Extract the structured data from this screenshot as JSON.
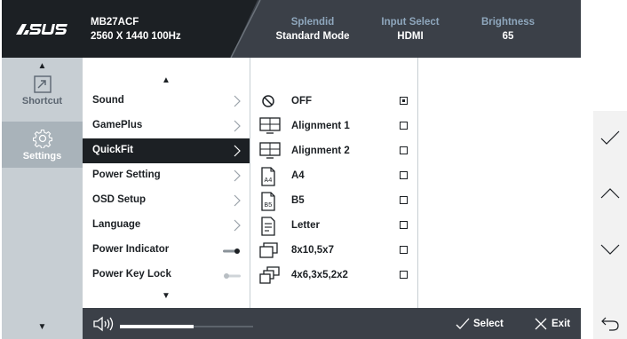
{
  "header": {
    "brand": "ASUS",
    "model_name": "MB27ACF",
    "model_resolution": "2560 X 1440 100Hz",
    "items": [
      {
        "label": "Splendid",
        "value": "Standard Mode"
      },
      {
        "label": "Input Select",
        "value": "HDMI"
      },
      {
        "label": "Brightness",
        "value": "65"
      }
    ]
  },
  "sidebar": {
    "items": [
      {
        "label": "Shortcut",
        "icon": "shortcut-icon",
        "active": false
      },
      {
        "label": "Settings",
        "icon": "gear-icon",
        "active": true
      }
    ]
  },
  "menu": {
    "items": [
      {
        "label": "Sound",
        "type": "submenu",
        "active": false
      },
      {
        "label": "GamePlus",
        "type": "submenu",
        "active": false
      },
      {
        "label": "QuickFit",
        "type": "submenu",
        "active": true
      },
      {
        "label": "Power Setting",
        "type": "submenu",
        "active": false
      },
      {
        "label": "OSD Setup",
        "type": "submenu",
        "active": false
      },
      {
        "label": "Language",
        "type": "submenu",
        "active": false
      },
      {
        "label": "Power Indicator",
        "type": "toggle",
        "on": true
      },
      {
        "label": "Power Key Lock",
        "type": "toggle",
        "on": false
      }
    ]
  },
  "options": {
    "items": [
      {
        "label": "OFF",
        "icon": "off-circle-icon",
        "checked": true
      },
      {
        "label": "Alignment 1",
        "icon": "alignment-grid-icon",
        "checked": false
      },
      {
        "label": "Alignment 2",
        "icon": "alignment-grid-icon",
        "checked": false
      },
      {
        "label": "A4",
        "icon": "a4-paper-icon",
        "checked": false
      },
      {
        "label": "B5",
        "icon": "b5-paper-icon",
        "checked": false
      },
      {
        "label": "Letter",
        "icon": "letter-paper-icon",
        "checked": false
      },
      {
        "label": "8x10,5x7",
        "icon": "photo-frame-icon",
        "checked": false
      },
      {
        "label": "4x6,3x5,2x2",
        "icon": "photo-frame-stack-icon",
        "checked": false
      }
    ]
  },
  "bottom": {
    "volume_fraction": 0.55,
    "select_label": "Select",
    "exit_label": "Exit"
  },
  "right_panel": {
    "buttons": [
      "check-icon",
      "up-chevron-icon",
      "down-chevron-icon",
      "back-arrow-icon"
    ]
  },
  "colors": {
    "header_bg": "#3b4048",
    "dark_bg": "#1c2024",
    "sidebar_bg": "#c7ced3",
    "header_label": "#8fa7bd"
  }
}
